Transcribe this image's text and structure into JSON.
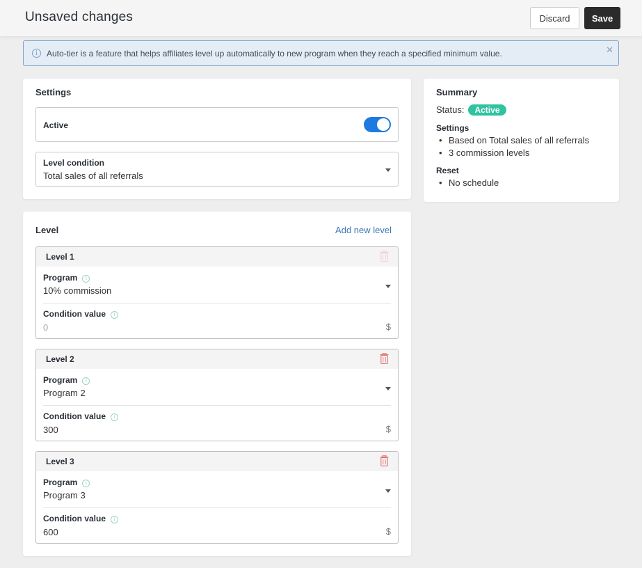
{
  "header": {
    "title": "Unsaved changes",
    "discard_label": "Discard",
    "save_label": "Save"
  },
  "banner": {
    "icon": "info-icon",
    "text": "Auto-tier is a feature that helps affiliates level up automatically to new program when they reach a specified minimum value.",
    "close_icon": "close-icon"
  },
  "settings": {
    "title": "Settings",
    "active_label": "Active",
    "active_on": true,
    "level_condition_label": "Level condition",
    "level_condition_value": "Total sales of all referrals"
  },
  "summary": {
    "title": "Summary",
    "status_label": "Status:",
    "status_value": "Active",
    "status_color": "#2fc3a0",
    "settings_heading": "Settings",
    "settings_items": [
      "Based on Total sales of all referrals",
      "3 commission levels"
    ],
    "reset_heading": "Reset",
    "reset_items": [
      "No schedule"
    ]
  },
  "levels": {
    "title": "Level",
    "add_label": "Add new level",
    "items": [
      {
        "name": "Level 1",
        "program_label": "Program",
        "program_value": "10% commission",
        "condition_label": "Condition value",
        "condition_value": "",
        "condition_placeholder": "0",
        "currency": "$",
        "delete_enabled": false
      },
      {
        "name": "Level 2",
        "program_label": "Program",
        "program_value": "Program 2",
        "condition_label": "Condition value",
        "condition_value": "300",
        "currency": "$",
        "delete_enabled": true
      },
      {
        "name": "Level 3",
        "program_label": "Program",
        "program_value": "Program 3",
        "condition_label": "Condition value",
        "condition_value": "600",
        "currency": "$",
        "delete_enabled": true
      }
    ]
  },
  "colors": {
    "toggle_on": "#1f7ae0",
    "delete_icon": "#e57373",
    "link": "#3d78b6"
  }
}
